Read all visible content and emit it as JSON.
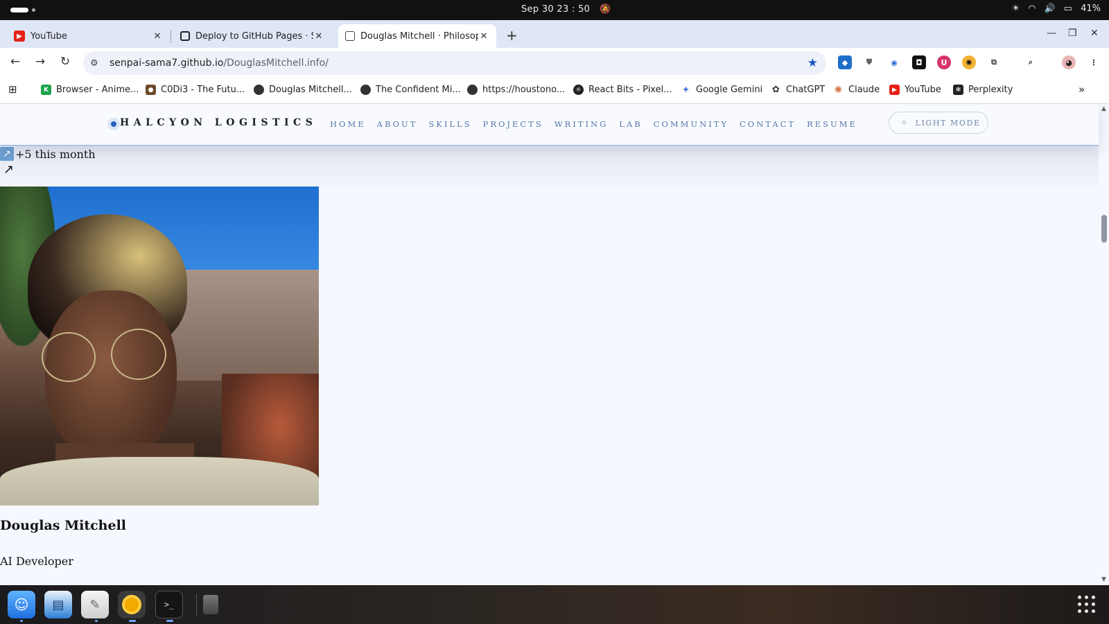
{
  "os_bar": {
    "clock": "Sep 30  23 : 50",
    "battery": "41%"
  },
  "tabs": [
    {
      "title": "YouTube",
      "icon": "youtube-icon"
    },
    {
      "title": "Deploy to GitHub Pages · Se",
      "icon": "github-icon"
    },
    {
      "title": "Douglas Mitchell · Philosop",
      "icon": "globe-icon",
      "active": true
    }
  ],
  "address_bar": {
    "host": "senpai-sama7.github.io",
    "path": "/DouglasMitchell.info/"
  },
  "bookmarks": [
    {
      "label": "Browser - Anime...",
      "color": "#1aa34a"
    },
    {
      "label": "C0Di3 - The Futu...",
      "color": "#6b4a2b"
    },
    {
      "label": "Douglas Mitchell...",
      "color": "#333333"
    },
    {
      "label": "The Confident Mi...",
      "color": "#333333"
    },
    {
      "label": "https://houstono...",
      "color": "#333333"
    },
    {
      "label": "React Bits - Pixel...",
      "color": "#222222"
    },
    {
      "label": "Google Gemini",
      "color": "#4a7be0"
    },
    {
      "label": "ChatGPT",
      "color": "#333333"
    },
    {
      "label": "Claude",
      "color": "#d9774b"
    },
    {
      "label": "YouTube",
      "color": "#e62117"
    },
    {
      "label": "Perplexity",
      "color": "#222222"
    }
  ],
  "site": {
    "logo": "HALCYON LOGISTICS",
    "nav": [
      "HOME",
      "ABOUT",
      "SKILLS",
      "PROJECTS",
      "WRITING",
      "LAB",
      "COMMUNITY",
      "CONTACT",
      "RESUME"
    ],
    "mode_button": "LIGHT MODE",
    "trend_text": "+5 this month",
    "profile_name": "Douglas Mitchell",
    "profile_role": "AI Developer"
  },
  "colors": {
    "accent": "#2a5fc4",
    "nav_link": "#5676a8",
    "page_bg": "#f5f8fe"
  }
}
